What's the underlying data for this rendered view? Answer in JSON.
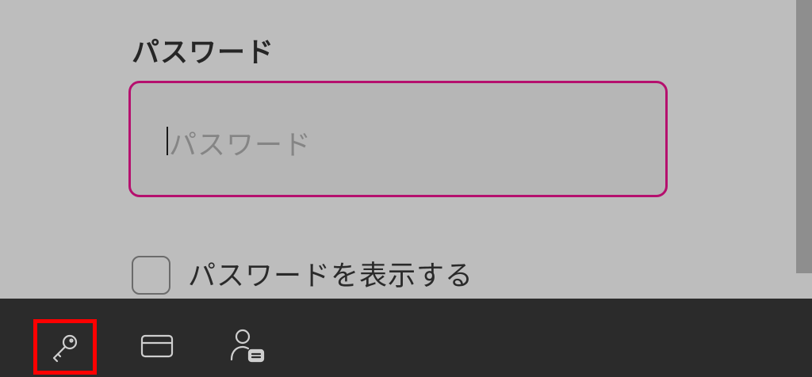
{
  "form": {
    "password_label": "パスワード",
    "password_value": "",
    "password_placeholder": "パスワード",
    "show_password_label": "パスワードを表示する",
    "show_password_checked": false
  },
  "autofill_bar": {
    "items": [
      {
        "icon": "key-icon",
        "highlighted": true
      },
      {
        "icon": "credit-card-icon",
        "highlighted": false
      },
      {
        "icon": "contact-card-icon",
        "highlighted": false
      }
    ]
  },
  "colors": {
    "input_border": "#b5106e",
    "highlight": "#ff0000",
    "bar_background": "#2b2b2b"
  }
}
